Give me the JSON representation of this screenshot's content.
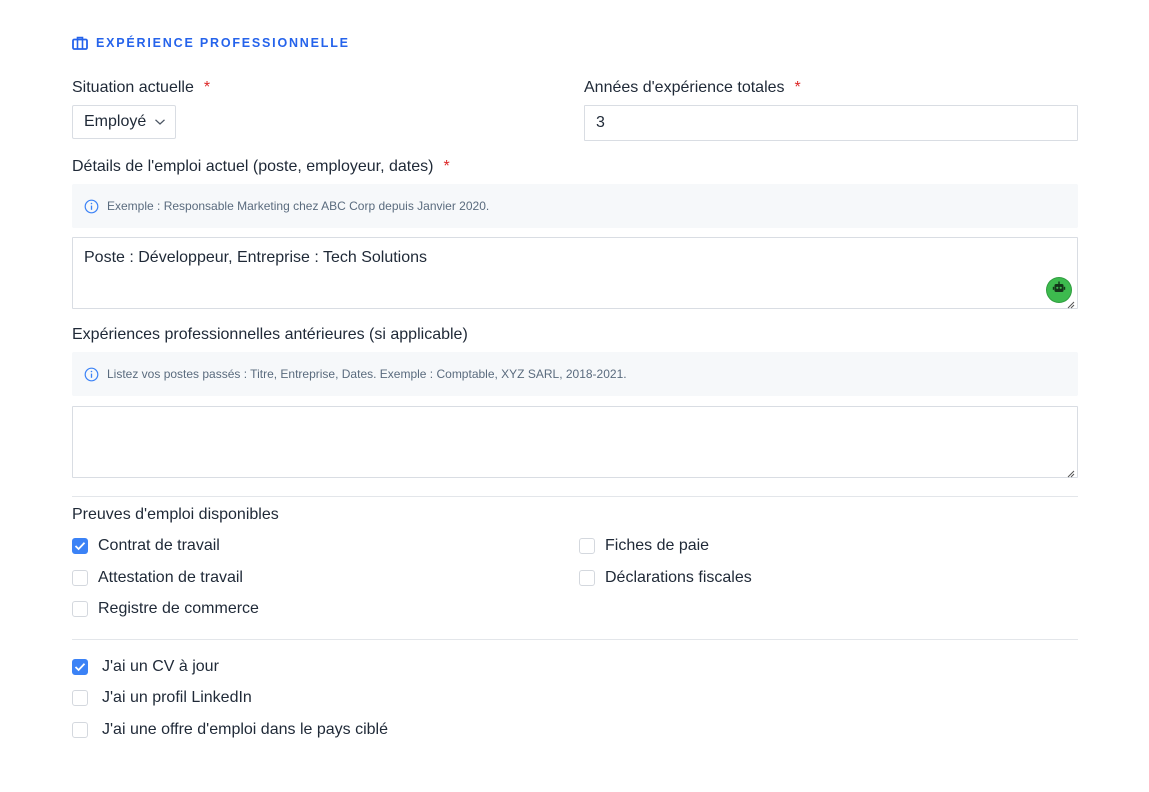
{
  "section": {
    "icon": "briefcase-icon",
    "title": "EXPÉRIENCE PROFESSIONNELLE",
    "accent_color": "#2563eb"
  },
  "situation": {
    "label": "Situation actuelle",
    "required_mark": "*",
    "value": "Employé"
  },
  "years": {
    "label": "Années d'expérience totales",
    "required_mark": "*",
    "value": "3"
  },
  "current_job": {
    "label": "Détails de l'emploi actuel (poste, employeur, dates)",
    "required_mark": "*",
    "hint": "Exemple : Responsable Marketing chez ABC Corp depuis Janvier 2020.",
    "value": "Poste : Développeur, Entreprise : Tech Solutions"
  },
  "previous_jobs": {
    "label": "Expériences professionnelles antérieures (si applicable)",
    "hint": "Listez vos postes passés : Titre, Entreprise, Dates. Exemple : Comptable, XYZ SARL, 2018-2021.",
    "value": ""
  },
  "proofs": {
    "label": "Preuves d'emploi disponibles",
    "items": [
      {
        "label": "Contrat de travail",
        "checked": true
      },
      {
        "label": "Fiches de paie",
        "checked": false
      },
      {
        "label": "Attestation de travail",
        "checked": false
      },
      {
        "label": "Déclarations fiscales",
        "checked": false
      },
      {
        "label": "Registre de commerce",
        "checked": false
      }
    ]
  },
  "extras": {
    "items": [
      {
        "label": "J'ai un CV à jour",
        "checked": true
      },
      {
        "label": "J'ai un profil LinkedIn",
        "checked": false
      },
      {
        "label": "J'ai une offre d'emploi dans le pays ciblé",
        "checked": false
      }
    ]
  },
  "colors": {
    "checkbox_checked": "#3b82f6",
    "required": "#dc2626",
    "assistant_button": "#3dba4e"
  }
}
